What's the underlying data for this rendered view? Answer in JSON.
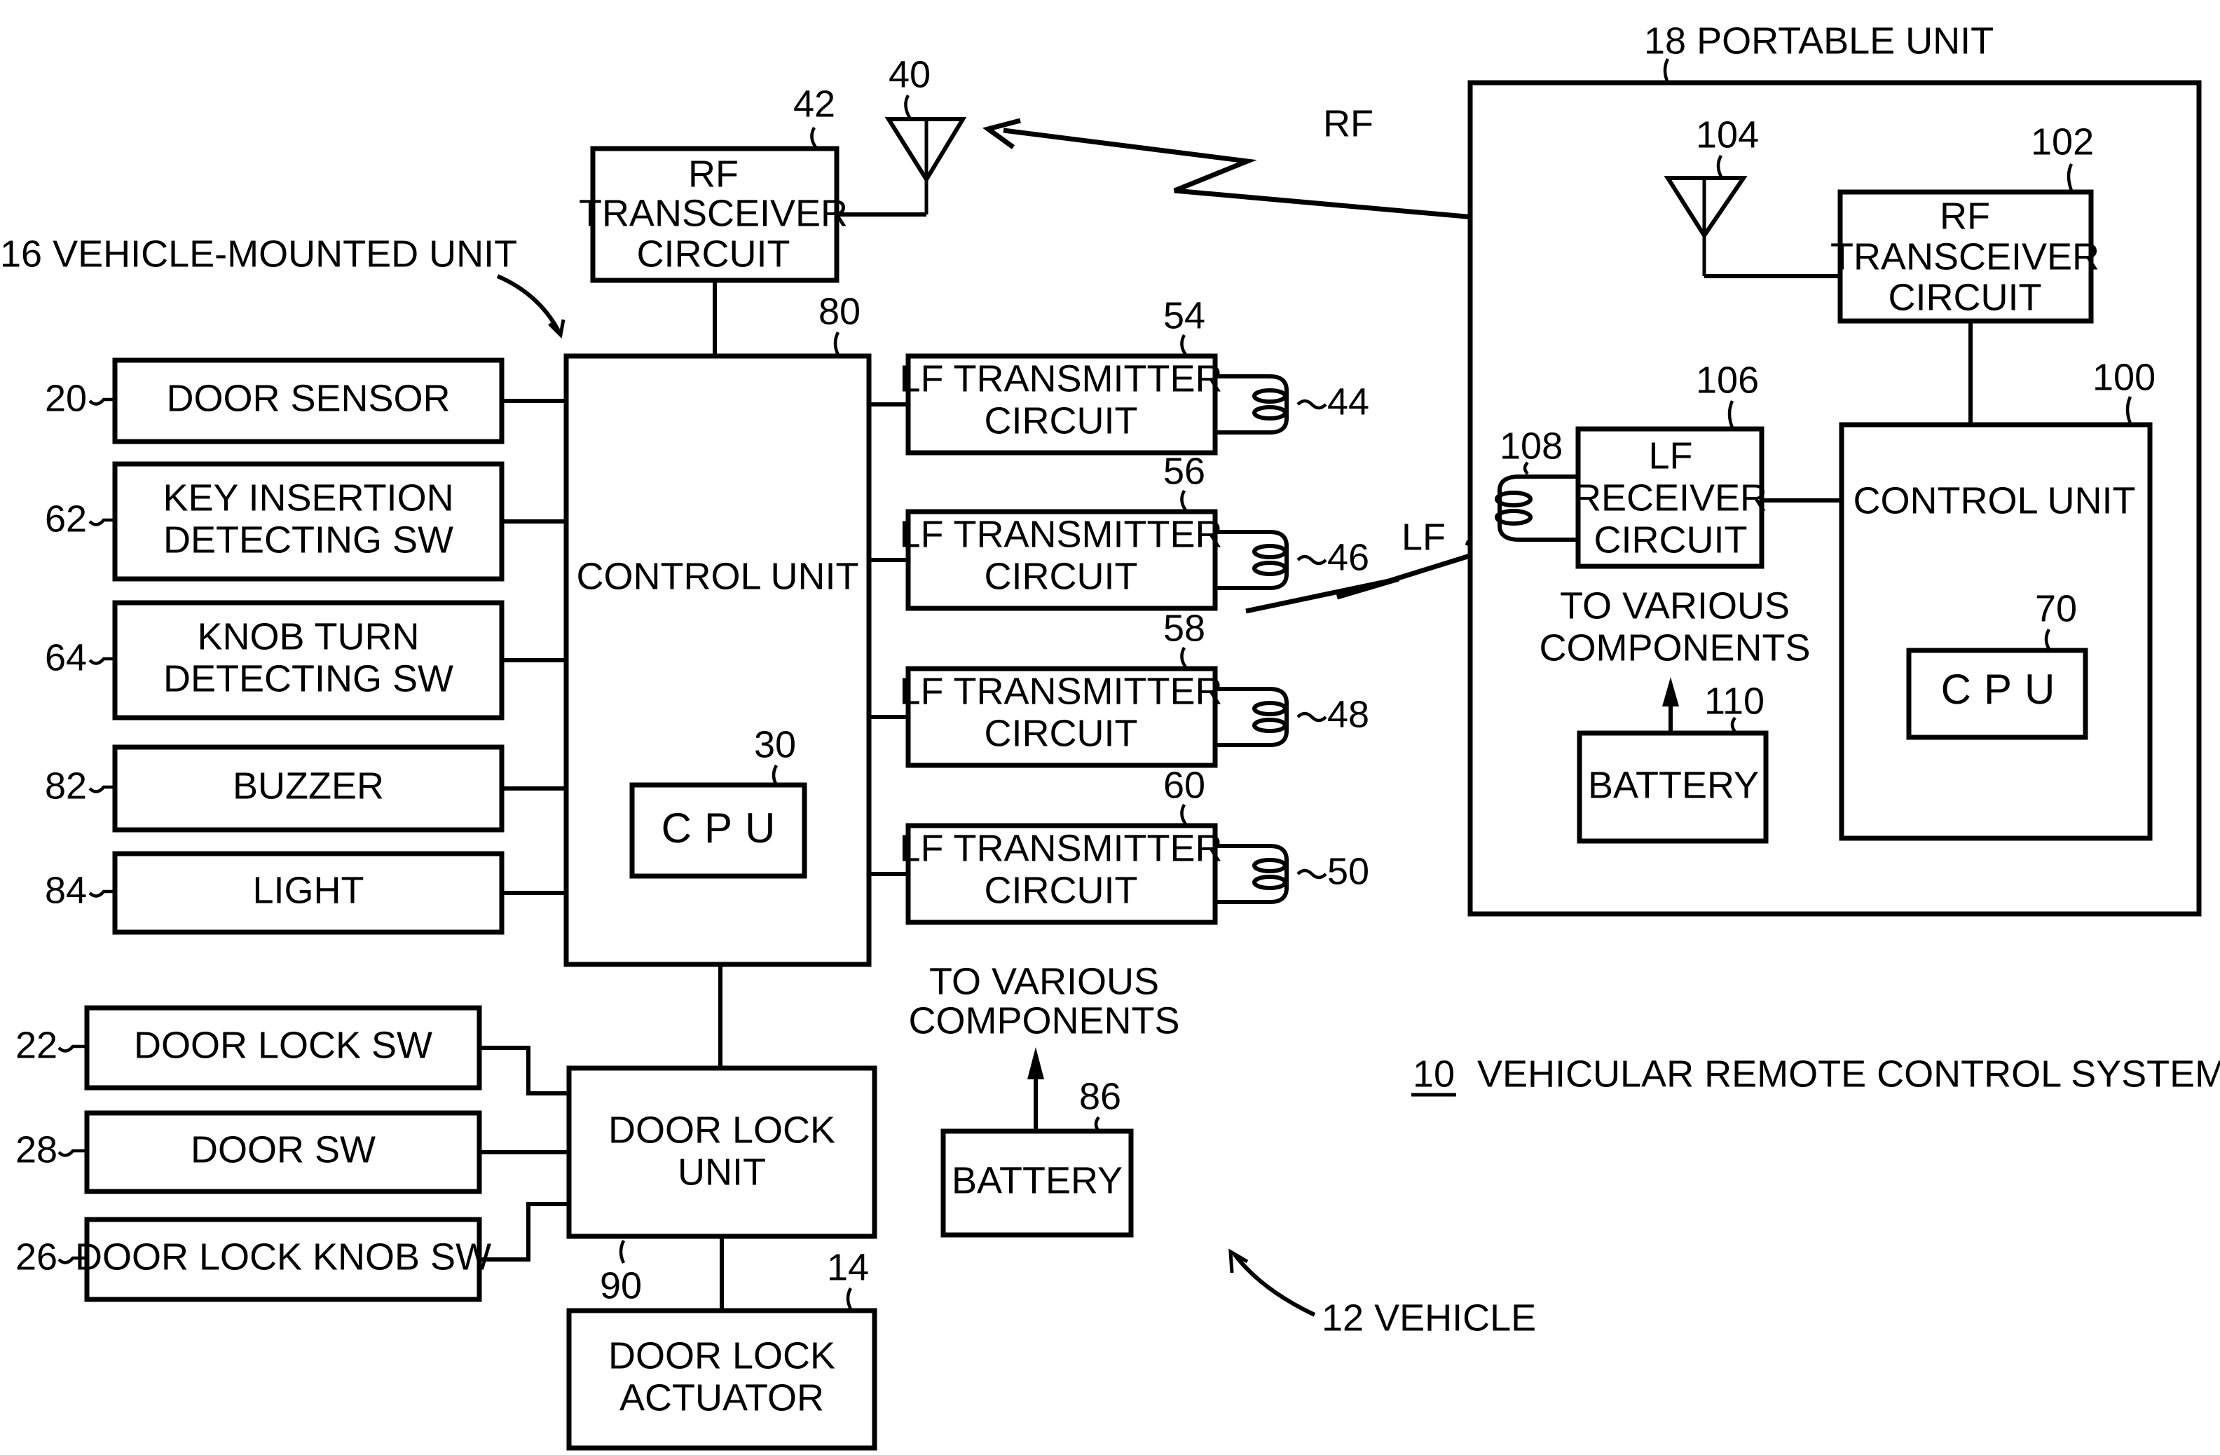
{
  "captions": {
    "system": {
      "number": "10",
      "text": "VEHICULAR REMOTE CONTROL SYSTEM"
    },
    "vehicle": "12 VEHICLE",
    "vehicle_mounted_unit": "16 VEHICLE-MOUNTED UNIT",
    "portable_unit": "18 PORTABLE UNIT",
    "rf_link": "RF",
    "lf_link": "LF"
  },
  "vehicle_unit": {
    "rf_transceiver": {
      "ref": "42",
      "lines": [
        "RF",
        "TRANSCEIVER",
        "CIRCUIT"
      ]
    },
    "antenna": {
      "ref": "40"
    },
    "control_unit": {
      "ref": "80",
      "label": "CONTROL UNIT"
    },
    "cpu": {
      "ref": "30",
      "label": "CPU"
    },
    "inputs": [
      {
        "ref": "20",
        "lines": [
          "DOOR SENSOR"
        ]
      },
      {
        "ref": "62",
        "lines": [
          "KEY INSERTION",
          "DETECTING SW"
        ]
      },
      {
        "ref": "64",
        "lines": [
          "KNOB TURN",
          "DETECTING SW"
        ]
      },
      {
        "ref": "82",
        "lines": [
          "BUZZER"
        ]
      },
      {
        "ref": "84",
        "lines": [
          "LIGHT"
        ]
      }
    ],
    "lf_transmitters": [
      {
        "ref": "54",
        "coil_ref": "44",
        "lines": [
          "LF TRANSMITTER",
          "CIRCUIT"
        ]
      },
      {
        "ref": "56",
        "coil_ref": "46",
        "lines": [
          "LF TRANSMITTER",
          "CIRCUIT"
        ]
      },
      {
        "ref": "58",
        "coil_ref": "48",
        "lines": [
          "LF TRANSMITTER",
          "CIRCUIT"
        ]
      },
      {
        "ref": "60",
        "coil_ref": "50",
        "lines": [
          "LF TRANSMITTER",
          "CIRCUIT"
        ]
      }
    ],
    "door_switches": [
      {
        "ref": "22",
        "label": "DOOR LOCK SW"
      },
      {
        "ref": "28",
        "label": "DOOR SW"
      },
      {
        "ref": "26",
        "label": "DOOR LOCK KNOB SW"
      }
    ],
    "door_lock_unit": {
      "ref": "90",
      "lines": [
        "DOOR LOCK",
        "UNIT"
      ]
    },
    "door_lock_actuator": {
      "ref": "14",
      "lines": [
        "DOOR LOCK",
        "ACTUATOR"
      ]
    },
    "battery": {
      "ref": "86",
      "label": "BATTERY",
      "note": [
        "TO VARIOUS",
        "COMPONENTS"
      ]
    }
  },
  "portable_unit": {
    "antenna": {
      "ref": "104"
    },
    "rf_transceiver": {
      "ref": "102",
      "lines": [
        "RF",
        "TRANSCEIVER",
        "CIRCUIT"
      ]
    },
    "lf_receiver": {
      "ref": "106",
      "lines": [
        "LF",
        "RECEIVER",
        "CIRCUIT"
      ]
    },
    "coil": {
      "ref": "108"
    },
    "control_unit": {
      "ref": "100",
      "label": "CONTROL UNIT"
    },
    "cpu": {
      "ref": "70",
      "label": "CPU"
    },
    "battery": {
      "ref": "110",
      "label": "BATTERY",
      "note": [
        "TO VARIOUS",
        "COMPONENTS"
      ]
    }
  }
}
